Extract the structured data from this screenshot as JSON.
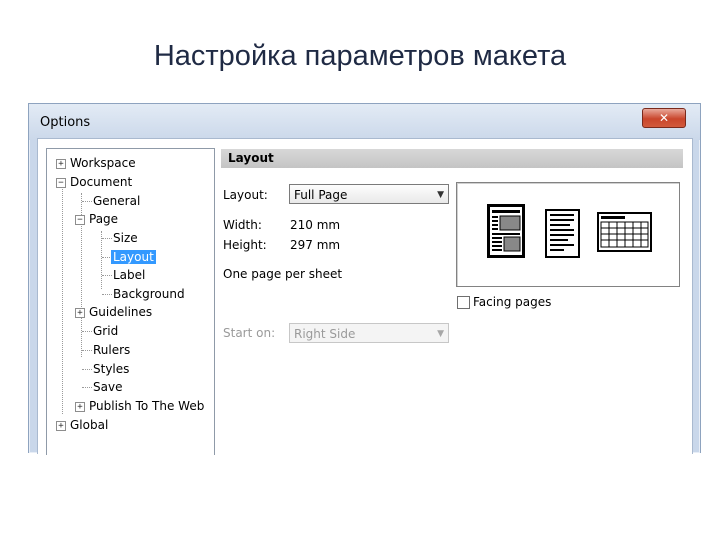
{
  "slide": {
    "title": "Настройка параметров макета"
  },
  "window": {
    "title": "Options",
    "close_icon": "✕"
  },
  "tree": {
    "items": [
      {
        "label": "Workspace",
        "expander": "+"
      },
      {
        "label": "Document",
        "expander": "−"
      },
      {
        "label": "General"
      },
      {
        "label": "Page",
        "expander": "−"
      },
      {
        "label": "Size"
      },
      {
        "label": "Layout",
        "selected": true
      },
      {
        "label": "Label"
      },
      {
        "label": "Background"
      },
      {
        "label": "Guidelines",
        "expander": "+"
      },
      {
        "label": "Grid"
      },
      {
        "label": "Rulers"
      },
      {
        "label": "Styles"
      },
      {
        "label": "Save"
      },
      {
        "label": "Publish To The Web",
        "expander": "+"
      },
      {
        "label": "Global",
        "expander": "+"
      }
    ]
  },
  "panel": {
    "header": "Layout",
    "layout_label": "Layout:",
    "layout_value": "Full Page",
    "width_label": "Width:",
    "width_value": "210 mm",
    "height_label": "Height:",
    "height_value": "297 mm",
    "pages_note": "One page per sheet",
    "facing_pages_label": "Facing pages",
    "facing_pages_checked": false,
    "start_on_label": "Start on:",
    "start_on_value": "Right Side"
  },
  "icons": {
    "dropdown_arrow": "▼",
    "preview": [
      "full-page-layout-icon",
      "book-layout-icon",
      "table-layout-icon"
    ]
  }
}
